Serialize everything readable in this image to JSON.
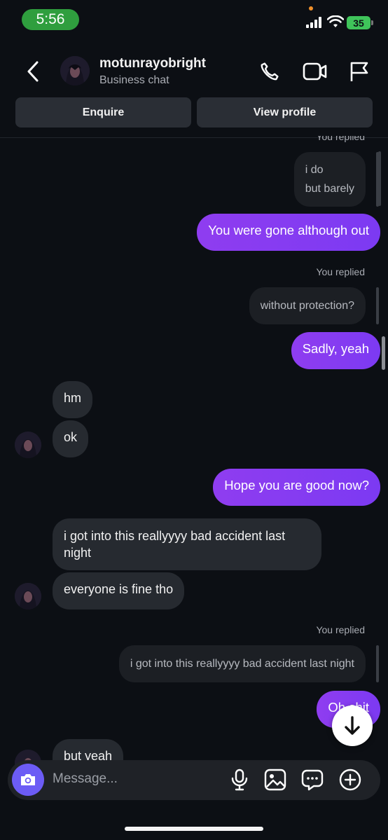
{
  "status_bar": {
    "time": "5:56",
    "battery": "35"
  },
  "header": {
    "username": "motunrayobright",
    "subtitle": "Business chat",
    "enquire_label": "Enquire",
    "view_profile_label": "View profile"
  },
  "messages": {
    "top_meta": "You replied",
    "m1_quote_line1": "i do",
    "m1_quote_line2": "but barely",
    "m2_out": "You were gone although out",
    "m3_meta": "You replied",
    "m3_quote": "without protection?",
    "m4_out": "Sadly, yeah",
    "m5_in": "hm",
    "m6_in": "ok",
    "m7_out": "Hope you are good now?",
    "m8_in_line1": "i got into this reallyyyy bad accident last",
    "m8_in_line2": "night",
    "m9_in": "everyone is fine tho",
    "m10_meta": "You replied",
    "m10_quote": "i got into this reallyyyy bad accident last night",
    "m11_out": "Oh shit",
    "m12_in": "but yeah"
  },
  "composer": {
    "placeholder": "Message..."
  },
  "colors": {
    "accent": "#7c3af2",
    "camera": "#6c5cf5",
    "background": "#0c0f14"
  }
}
